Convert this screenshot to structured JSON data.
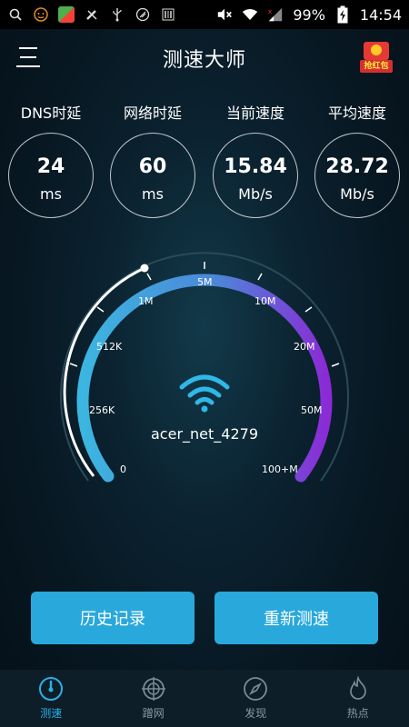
{
  "status_bar": {
    "battery": "99%",
    "time": "14:54",
    "icons": [
      "search-icon",
      "face-icon",
      "app-icon",
      "tools-icon",
      "usb-icon",
      "clean-icon",
      "barcode-icon",
      "mute-icon",
      "wifi-icon",
      "signal-icon",
      "battery-icon"
    ]
  },
  "header": {
    "title": "测速大师",
    "red_packet": "抢红包"
  },
  "metrics": [
    {
      "label": "DNS时延",
      "value": "24",
      "unit": "ms"
    },
    {
      "label": "网络时延",
      "value": "60",
      "unit": "ms"
    },
    {
      "label": "当前速度",
      "value": "15.84",
      "unit": "Mb/s"
    },
    {
      "label": "平均速度",
      "value": "28.72",
      "unit": "Mb/s"
    }
  ],
  "gauge": {
    "ticks": [
      "0",
      "256K",
      "512K",
      "1M",
      "5M",
      "10M",
      "20M",
      "50M",
      "100+M"
    ],
    "network_name": "acer_net_4279",
    "colors": {
      "start": "#3bb6e0",
      "end": "#8a2bd6",
      "track": "#2a4a58"
    }
  },
  "buttons": {
    "history": "历史记录",
    "retest": "重新测速"
  },
  "tabs": [
    {
      "label": "测速",
      "icon": "speedometer-icon"
    },
    {
      "label": "蹭网",
      "icon": "crosshair-icon"
    },
    {
      "label": "发现",
      "icon": "compass-icon"
    },
    {
      "label": "热点",
      "icon": "flame-icon"
    }
  ]
}
